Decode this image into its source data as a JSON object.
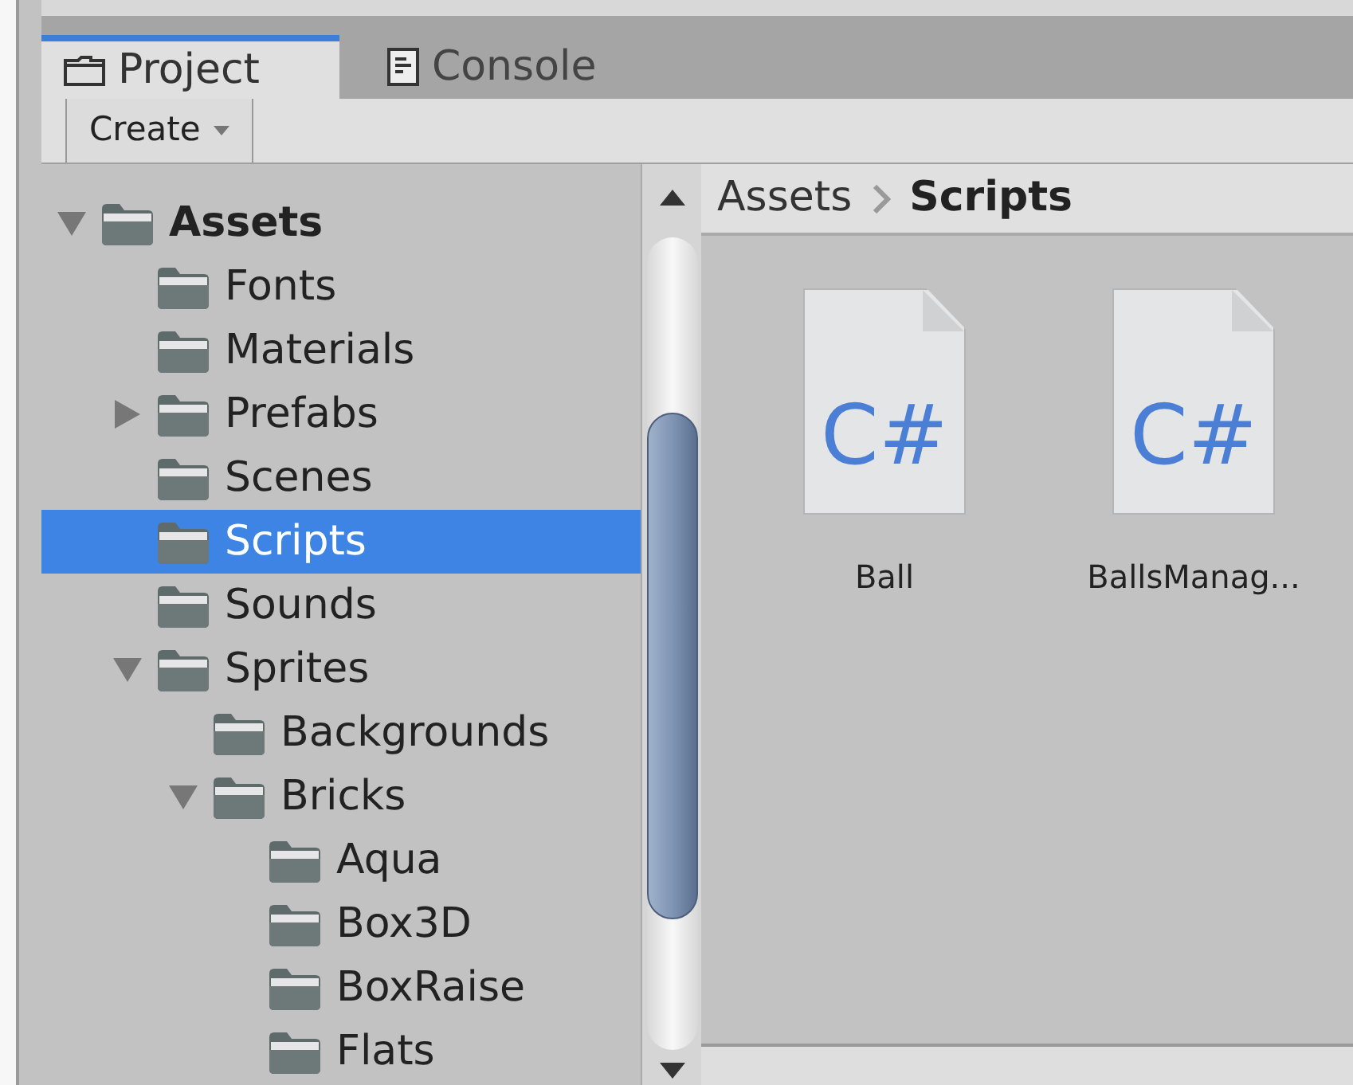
{
  "tabs": [
    {
      "label": "Project",
      "selected": true
    },
    {
      "label": "Console",
      "selected": false
    }
  ],
  "toolbar": {
    "create_button": "Create"
  },
  "tree": [
    {
      "label": "Assets",
      "expanded": true,
      "selected": false,
      "children": [
        {
          "label": "Fonts",
          "selected": false
        },
        {
          "label": "Materials",
          "selected": false
        },
        {
          "label": "Prefabs",
          "expanded": false,
          "selected": false
        },
        {
          "label": "Scenes",
          "selected": false
        },
        {
          "label": "Scripts",
          "selected": true
        },
        {
          "label": "Sounds",
          "selected": false
        },
        {
          "label": "Sprites",
          "expanded": true,
          "selected": false,
          "children": [
            {
              "label": "Backgrounds",
              "selected": false
            },
            {
              "label": "Bricks",
              "expanded": true,
              "selected": false,
              "children": [
                {
                  "label": "Aqua",
                  "selected": false
                },
                {
                  "label": "Box3D",
                  "selected": false
                },
                {
                  "label": "BoxRaise",
                  "selected": false
                },
                {
                  "label": "Flats",
                  "selected": false
                }
              ]
            }
          ]
        }
      ]
    }
  ],
  "breadcrumb": [
    {
      "label": "Assets",
      "current": false
    },
    {
      "label": "Scripts",
      "current": true
    }
  ],
  "files": [
    {
      "name": "Ball",
      "icon_text": "C#"
    },
    {
      "name": "BallsManag...",
      "icon_text": "C#"
    }
  ]
}
